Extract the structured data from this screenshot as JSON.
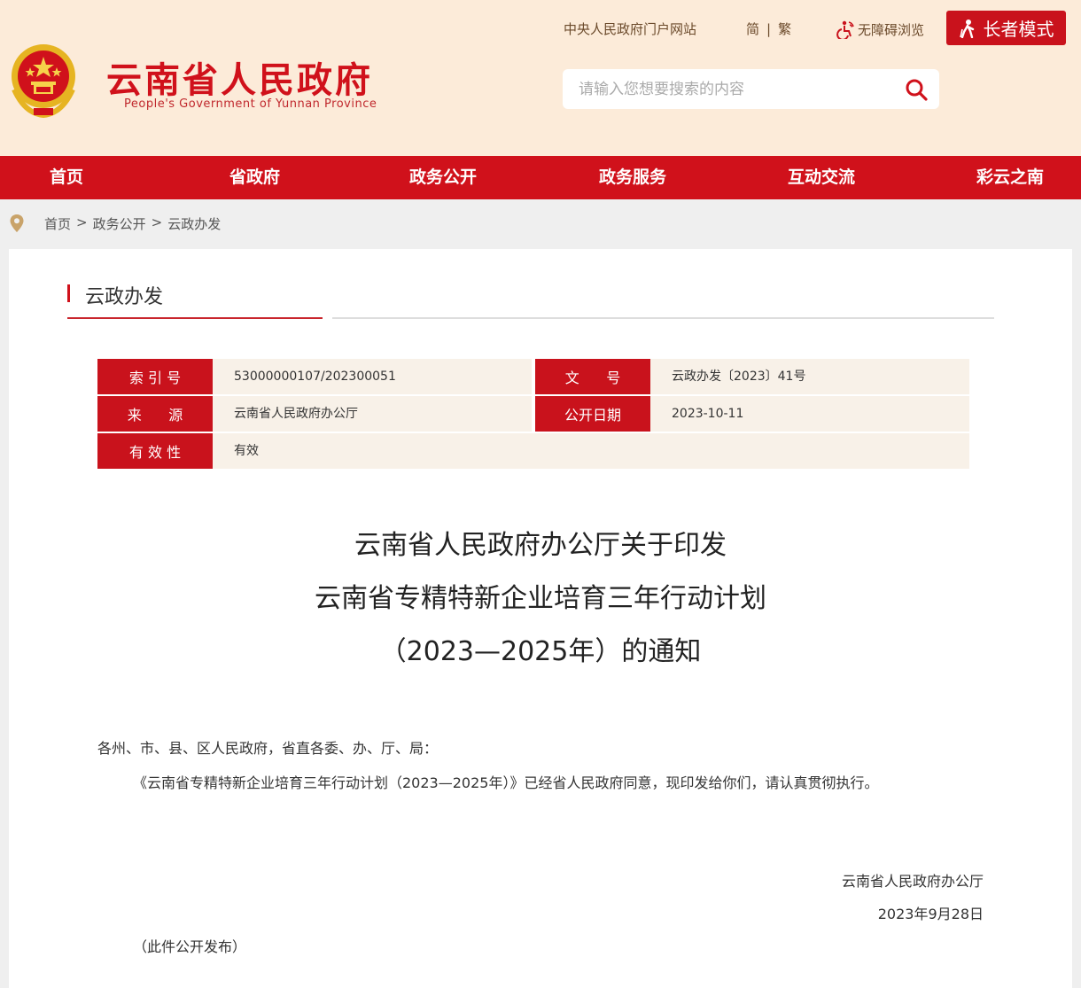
{
  "header": {
    "site_title": "云南省人民政府",
    "site_subtitle": "People's Government of Yunnan Province",
    "portal_link": "中央人民政府门户网站",
    "lang_simplified": "简",
    "lang_separator": "|",
    "lang_traditional": "繁",
    "accessibility_label": "无障碍浏览",
    "elder_mode_label": "长者模式",
    "search_placeholder": "请输入您想要搜索的内容"
  },
  "nav": {
    "items": [
      {
        "label": "首页"
      },
      {
        "label": "省政府"
      },
      {
        "label": "政务公开"
      },
      {
        "label": "政务服务"
      },
      {
        "label": "互动交流"
      },
      {
        "label": "彩云之南"
      }
    ]
  },
  "breadcrumb": {
    "items": [
      "首页",
      "政务公开",
      "云政办发"
    ],
    "separator": ">"
  },
  "section": {
    "title": "云政办发"
  },
  "meta": {
    "index_label": "索 引 号",
    "index_value": "53000000107/202300051",
    "docno_label": "文      号",
    "docno_value": "云政办发〔2023〕41号",
    "source_label": "来      源",
    "source_value": "云南省人民政府办公厅",
    "date_label": "公开日期",
    "date_value": "2023-10-11",
    "validity_label": "有 效 性",
    "validity_value": "有效"
  },
  "article": {
    "title_lines": [
      "云南省人民政府办公厅关于印发",
      "云南省专精特新企业培育三年行动计划",
      "（2023—2025年）的通知"
    ],
    "salutation": "各州、市、县、区人民政府，省直各委、办、厅、局：",
    "body": "《云南省专精特新企业培育三年行动计划（2023—2025年）》已经省人民政府同意，现印发给你们，请认真贯彻执行。",
    "signature_org": "云南省人民政府办公厅",
    "signature_date": "2023年9月28日",
    "note": "（此件公开发布）"
  },
  "colors": {
    "brand_red": "#d0111b",
    "header_bg": "#fcebd9",
    "meta_bg": "#f8f1e8"
  },
  "icons": {
    "emblem": "national-emblem-icon",
    "accessibility": "accessibility-icon",
    "elder": "elder-person-icon",
    "search": "search-icon",
    "location": "location-pin-icon"
  }
}
